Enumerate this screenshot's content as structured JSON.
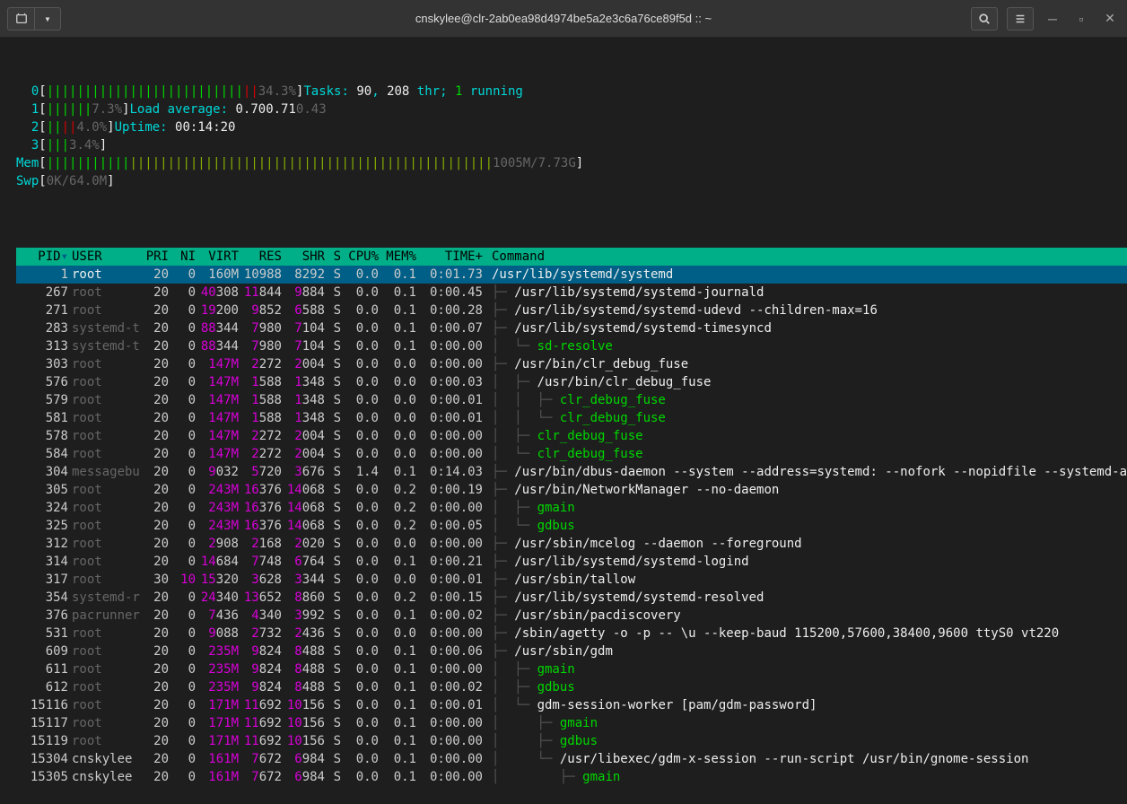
{
  "title": "cnskylee@clr-2ab0ea98d4974be5a2e3c6a76ce89f5d :: ~",
  "cpu": [
    {
      "id": "0",
      "bars": "||||||||||||||||||||||||||",
      "red": "||",
      "pct": "34.3%"
    },
    {
      "id": "1",
      "bars": "||||||",
      "red": "",
      "pct": "7.3%"
    },
    {
      "id": "2",
      "bars": "||",
      "red": "||",
      "pct": "4.0%"
    },
    {
      "id": "3",
      "bars": "|||",
      "red": "",
      "pct": "3.4%"
    }
  ],
  "mem": {
    "label": "Mem",
    "greens": "|||||||||||",
    "yellows": "||||||||||||||||||||||||||||||||||||||||||||||||",
    "val": "1005M/7.73G"
  },
  "swp": {
    "label": "Swp",
    "val": "0K/64.0M"
  },
  "summary": {
    "tasks_label": "Tasks: ",
    "tasks": "90",
    "comma": ", ",
    "thr": "208",
    "thr_label": " thr; ",
    "run": "1",
    "run_label": " running",
    "load_label": "Load average: ",
    "l1": "0.70",
    "l2": "0.71",
    "l3": "0.43",
    "uptime_label": "Uptime: ",
    "uptime": "00:14:20"
  },
  "headers": [
    "PID",
    "USER",
    "PRI",
    "NI",
    "VIRT",
    "RES",
    "SHR",
    "S",
    "CPU%",
    "MEM%",
    "TIME+",
    "Command"
  ],
  "rows": [
    {
      "pid": "1",
      "user": "root",
      "sel": true,
      "pri": "20",
      "ni": "0",
      "virt": "160M",
      "res": "10988",
      "shr": "8292",
      "s": "S",
      "cpu": "0.0",
      "mem": "0.1",
      "time": "0:01.73",
      "cmd": "/usr/lib/systemd/systemd",
      "tree": "",
      "cmdcol": "#eee"
    },
    {
      "pid": "267",
      "user": "root",
      "pri": "20",
      "ni": "0",
      "virt": "40308",
      "virtHi": "40",
      "res": "11844",
      "resHi": "11",
      "shr": "9884",
      "shrHi": "9",
      "s": "S",
      "cpu": "0.0",
      "mem": "0.1",
      "time": "0:00.45",
      "tree": "├─ ",
      "cmd": "/usr/lib/systemd/systemd-journald",
      "cmdcol": "#eee"
    },
    {
      "pid": "271",
      "user": "root",
      "pri": "20",
      "ni": "0",
      "virt": "19200",
      "virtHi": "19",
      "res": "9852",
      "resHi": "9",
      "shr": "6588",
      "shrHi": "6",
      "s": "S",
      "cpu": "0.0",
      "mem": "0.1",
      "time": "0:00.28",
      "tree": "├─ ",
      "cmd": "/usr/lib/systemd/systemd-udevd --children-max=16",
      "cmdcol": "#eee"
    },
    {
      "pid": "283",
      "user": "systemd-t",
      "pri": "20",
      "ni": "0",
      "virt": "88344",
      "virtHi": "88",
      "res": "7980",
      "resHi": "7",
      "shr": "7104",
      "shrHi": "7",
      "s": "S",
      "cpu": "0.0",
      "mem": "0.1",
      "time": "0:00.07",
      "tree": "├─ ",
      "cmd": "/usr/lib/systemd/systemd-timesyncd",
      "cmdcol": "#eee"
    },
    {
      "pid": "313",
      "user": "systemd-t",
      "pri": "20",
      "ni": "0",
      "virt": "88344",
      "virtHi": "88",
      "res": "7980",
      "resHi": "7",
      "shr": "7104",
      "shrHi": "7",
      "s": "S",
      "cpu": "0.0",
      "mem": "0.1",
      "time": "0:00.00",
      "tree": "│  └─ ",
      "cmd": "sd-resolve",
      "cmdcol": "#00d700"
    },
    {
      "pid": "303",
      "user": "root",
      "pri": "20",
      "ni": "0",
      "virt": "147M",
      "virtCol": "#d700d7",
      "res": "2272",
      "resHi": "2",
      "shr": "2004",
      "shrHi": "2",
      "s": "S",
      "cpu": "0.0",
      "mem": "0.0",
      "time": "0:00.00",
      "tree": "├─ ",
      "cmd": "/usr/bin/clr_debug_fuse",
      "cmdcol": "#eee"
    },
    {
      "pid": "576",
      "user": "root",
      "pri": "20",
      "ni": "0",
      "virt": "147M",
      "virtCol": "#d700d7",
      "res": "1588",
      "resHi": "1",
      "shr": "1348",
      "shrHi": "1",
      "s": "S",
      "cpu": "0.0",
      "mem": "0.0",
      "time": "0:00.03",
      "tree": "│  ├─ ",
      "cmd": "/usr/bin/clr_debug_fuse",
      "cmdcol": "#eee"
    },
    {
      "pid": "579",
      "user": "root",
      "pri": "20",
      "ni": "0",
      "virt": "147M",
      "virtCol": "#d700d7",
      "res": "1588",
      "resHi": "1",
      "shr": "1348",
      "shrHi": "1",
      "s": "S",
      "cpu": "0.0",
      "mem": "0.0",
      "time": "0:00.01",
      "tree": "│  │  ├─ ",
      "cmd": "clr_debug_fuse",
      "cmdcol": "#00d700"
    },
    {
      "pid": "581",
      "user": "root",
      "pri": "20",
      "ni": "0",
      "virt": "147M",
      "virtCol": "#d700d7",
      "res": "1588",
      "resHi": "1",
      "shr": "1348",
      "shrHi": "1",
      "s": "S",
      "cpu": "0.0",
      "mem": "0.0",
      "time": "0:00.01",
      "tree": "│  │  └─ ",
      "cmd": "clr_debug_fuse",
      "cmdcol": "#00d700"
    },
    {
      "pid": "578",
      "user": "root",
      "pri": "20",
      "ni": "0",
      "virt": "147M",
      "virtCol": "#d700d7",
      "res": "2272",
      "resHi": "2",
      "shr": "2004",
      "shrHi": "2",
      "s": "S",
      "cpu": "0.0",
      "mem": "0.0",
      "time": "0:00.00",
      "tree": "│  ├─ ",
      "cmd": "clr_debug_fuse",
      "cmdcol": "#00d700"
    },
    {
      "pid": "584",
      "user": "root",
      "pri": "20",
      "ni": "0",
      "virt": "147M",
      "virtCol": "#d700d7",
      "res": "2272",
      "resHi": "2",
      "shr": "2004",
      "shrHi": "2",
      "s": "S",
      "cpu": "0.0",
      "mem": "0.0",
      "time": "0:00.00",
      "tree": "│  └─ ",
      "cmd": "clr_debug_fuse",
      "cmdcol": "#00d700"
    },
    {
      "pid": "304",
      "user": "messagebu",
      "pri": "20",
      "ni": "0",
      "virt": "9032",
      "virtHi": "9",
      "res": "5720",
      "resHi": "5",
      "shr": "3676",
      "shrHi": "3",
      "s": "S",
      "cpu": "1.4",
      "mem": "0.1",
      "time": "0:14.03",
      "tree": "├─ ",
      "cmd": "/usr/bin/dbus-daemon --system --address=systemd: --nofork --nopidfile --systemd-activati",
      "cmdcol": "#eee"
    },
    {
      "pid": "305",
      "user": "root",
      "pri": "20",
      "ni": "0",
      "virt": "243M",
      "virtCol": "#d700d7",
      "res": "16376",
      "resHi": "16",
      "shr": "14068",
      "shrHi": "14",
      "s": "S",
      "cpu": "0.0",
      "mem": "0.2",
      "time": "0:00.19",
      "tree": "├─ ",
      "cmd": "/usr/bin/NetworkManager --no-daemon",
      "cmdcol": "#eee"
    },
    {
      "pid": "324",
      "user": "root",
      "pri": "20",
      "ni": "0",
      "virt": "243M",
      "virtCol": "#d700d7",
      "res": "16376",
      "resHi": "16",
      "shr": "14068",
      "shrHi": "14",
      "s": "S",
      "cpu": "0.0",
      "mem": "0.2",
      "time": "0:00.00",
      "tree": "│  ├─ ",
      "cmd": "gmain",
      "cmdcol": "#00d700"
    },
    {
      "pid": "325",
      "user": "root",
      "pri": "20",
      "ni": "0",
      "virt": "243M",
      "virtCol": "#d700d7",
      "res": "16376",
      "resHi": "16",
      "shr": "14068",
      "shrHi": "14",
      "s": "S",
      "cpu": "0.0",
      "mem": "0.2",
      "time": "0:00.05",
      "tree": "│  └─ ",
      "cmd": "gdbus",
      "cmdcol": "#00d700"
    },
    {
      "pid": "312",
      "user": "root",
      "pri": "20",
      "ni": "0",
      "virt": "2908",
      "virtHi": "2",
      "res": "2168",
      "resHi": "2",
      "shr": "2020",
      "shrHi": "2",
      "s": "S",
      "cpu": "0.0",
      "mem": "0.0",
      "time": "0:00.00",
      "tree": "├─ ",
      "cmd": "/usr/sbin/mcelog --daemon --foreground",
      "cmdcol": "#eee"
    },
    {
      "pid": "314",
      "user": "root",
      "pri": "20",
      "ni": "0",
      "virt": "14684",
      "virtHi": "14",
      "res": "7748",
      "resHi": "7",
      "shr": "6764",
      "shrHi": "6",
      "s": "S",
      "cpu": "0.0",
      "mem": "0.1",
      "time": "0:00.21",
      "tree": "├─ ",
      "cmd": "/usr/lib/systemd/systemd-logind",
      "cmdcol": "#eee"
    },
    {
      "pid": "317",
      "user": "root",
      "pri": "30",
      "ni": "10",
      "niCol": "#d700d7",
      "virt": "15320",
      "virtHi": "15",
      "res": "3628",
      "resHi": "3",
      "shr": "3344",
      "shrHi": "3",
      "s": "S",
      "cpu": "0.0",
      "mem": "0.0",
      "time": "0:00.01",
      "tree": "├─ ",
      "cmd": "/usr/sbin/tallow",
      "cmdcol": "#eee"
    },
    {
      "pid": "354",
      "user": "systemd-r",
      "pri": "20",
      "ni": "0",
      "virt": "24340",
      "virtHi": "24",
      "res": "13652",
      "resHi": "13",
      "shr": "8860",
      "shrHi": "8",
      "s": "S",
      "cpu": "0.0",
      "mem": "0.2",
      "time": "0:00.15",
      "tree": "├─ ",
      "cmd": "/usr/lib/systemd/systemd-resolved",
      "cmdcol": "#eee"
    },
    {
      "pid": "376",
      "user": "pacrunner",
      "pri": "20",
      "ni": "0",
      "virt": "7436",
      "virtHi": "7",
      "res": "4340",
      "resHi": "4",
      "shr": "3992",
      "shrHi": "3",
      "s": "S",
      "cpu": "0.0",
      "mem": "0.1",
      "time": "0:00.02",
      "tree": "├─ ",
      "cmd": "/usr/sbin/pacdiscovery",
      "cmdcol": "#eee"
    },
    {
      "pid": "531",
      "user": "root",
      "pri": "20",
      "ni": "0",
      "virt": "9088",
      "virtHi": "9",
      "res": "2732",
      "resHi": "2",
      "shr": "2436",
      "shrHi": "2",
      "s": "S",
      "cpu": "0.0",
      "mem": "0.0",
      "time": "0:00.00",
      "tree": "├─ ",
      "cmd": "/sbin/agetty -o -p -- \\u --keep-baud 115200,57600,38400,9600 ttyS0 vt220",
      "cmdcol": "#eee"
    },
    {
      "pid": "609",
      "user": "root",
      "pri": "20",
      "ni": "0",
      "virt": "235M",
      "virtCol": "#d700d7",
      "res": "9824",
      "resHi": "9",
      "shr": "8488",
      "shrHi": "8",
      "s": "S",
      "cpu": "0.0",
      "mem": "0.1",
      "time": "0:00.06",
      "tree": "├─ ",
      "cmd": "/usr/sbin/gdm",
      "cmdcol": "#eee"
    },
    {
      "pid": "611",
      "user": "root",
      "pri": "20",
      "ni": "0",
      "virt": "235M",
      "virtCol": "#d700d7",
      "res": "9824",
      "resHi": "9",
      "shr": "8488",
      "shrHi": "8",
      "s": "S",
      "cpu": "0.0",
      "mem": "0.1",
      "time": "0:00.00",
      "tree": "│  ├─ ",
      "cmd": "gmain",
      "cmdcol": "#00d700"
    },
    {
      "pid": "612",
      "user": "root",
      "pri": "20",
      "ni": "0",
      "virt": "235M",
      "virtCol": "#d700d7",
      "res": "9824",
      "resHi": "9",
      "shr": "8488",
      "shrHi": "8",
      "s": "S",
      "cpu": "0.0",
      "mem": "0.1",
      "time": "0:00.02",
      "tree": "│  ├─ ",
      "cmd": "gdbus",
      "cmdcol": "#00d700"
    },
    {
      "pid": "15116",
      "user": "root",
      "pri": "20",
      "ni": "0",
      "virt": "171M",
      "virtCol": "#d700d7",
      "res": "11692",
      "resHi": "11",
      "shr": "10156",
      "shrHi": "10",
      "s": "S",
      "cpu": "0.0",
      "mem": "0.1",
      "time": "0:00.01",
      "tree": "│  └─ ",
      "cmd": "gdm-session-worker [pam/gdm-password]",
      "cmdcol": "#eee"
    },
    {
      "pid": "15117",
      "user": "root",
      "pri": "20",
      "ni": "0",
      "virt": "171M",
      "virtCol": "#d700d7",
      "res": "11692",
      "resHi": "11",
      "shr": "10156",
      "shrHi": "10",
      "s": "S",
      "cpu": "0.0",
      "mem": "0.1",
      "time": "0:00.00",
      "tree": "│     ├─ ",
      "cmd": "gmain",
      "cmdcol": "#00d700"
    },
    {
      "pid": "15119",
      "user": "root",
      "pri": "20",
      "ni": "0",
      "virt": "171M",
      "virtCol": "#d700d7",
      "res": "11692",
      "resHi": "11",
      "shr": "10156",
      "shrHi": "10",
      "s": "S",
      "cpu": "0.0",
      "mem": "0.1",
      "time": "0:00.00",
      "tree": "│     ├─ ",
      "cmd": "gdbus",
      "cmdcol": "#00d700"
    },
    {
      "pid": "15304",
      "user": "cnskylee",
      "pri": "20",
      "ni": "0",
      "virt": "161M",
      "virtCol": "#d700d7",
      "res": "7672",
      "resHi": "7",
      "shr": "6984",
      "shrHi": "6",
      "s": "S",
      "cpu": "0.0",
      "mem": "0.1",
      "time": "0:00.00",
      "tree": "│     └─ ",
      "cmd": "/usr/libexec/gdm-x-session --run-script /usr/bin/gnome-session",
      "cmdcol": "#eee"
    },
    {
      "pid": "15305",
      "user": "cnskylee",
      "pri": "20",
      "ni": "0",
      "virt": "161M",
      "virtCol": "#d700d7",
      "res": "7672",
      "resHi": "7",
      "shr": "6984",
      "shrHi": "6",
      "s": "S",
      "cpu": "0.0",
      "mem": "0.1",
      "time": "0:00.00",
      "tree": "│        ├─ ",
      "cmd": "gmain",
      "cmdcol": "#00d700"
    }
  ]
}
